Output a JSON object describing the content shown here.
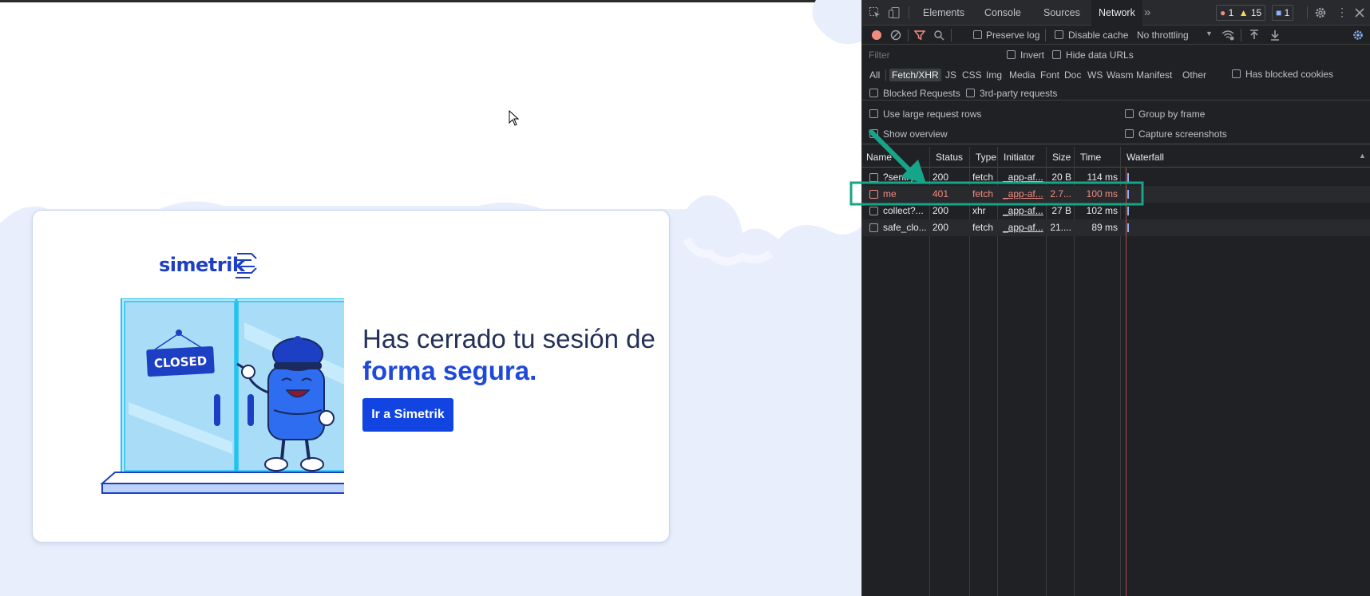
{
  "page": {
    "logo_text": "simetrik",
    "closed_sign": "CLOSED",
    "headline_line1": "Has cerrado tu sesión de",
    "headline_line2": "forma segura.",
    "cta_label": "Ir a Simetrik"
  },
  "devtools": {
    "tabs": [
      "Elements",
      "Console",
      "Sources",
      "Network"
    ],
    "active_tab": "Network",
    "more_tabs": "»",
    "errors_count": "1",
    "warnings_count": "15",
    "messages_count": "1",
    "toolbar": {
      "preserve_log": "Preserve log",
      "disable_cache": "Disable cache",
      "throttling": "No throttling"
    },
    "filter": {
      "placeholder": "Filter",
      "invert": "Invert",
      "hide_data_urls": "Hide data URLs",
      "types": [
        "All",
        "Fetch/XHR",
        "JS",
        "CSS",
        "Img",
        "Media",
        "Font",
        "Doc",
        "WS",
        "Wasm",
        "Manifest",
        "Other"
      ],
      "active_type": "Fetch/XHR",
      "has_blocked_cookies": "Has blocked cookies",
      "blocked_requests": "Blocked Requests",
      "third_party": "3rd-party requests"
    },
    "settings": {
      "large_rows": "Use large request rows",
      "group_by_frame": "Group by frame",
      "show_overview": "Show overview",
      "capture_screenshots": "Capture screenshots"
    },
    "columns": [
      "Name",
      "Status",
      "Type",
      "Initiator",
      "Size",
      "Time",
      "Waterfall"
    ],
    "rows": [
      {
        "name": "?sentry",
        "status": "200",
        "type": "fetch",
        "initiator": "_app-af...",
        "size": "20 B",
        "time": "114 ms",
        "error": false
      },
      {
        "name": "me",
        "status": "401",
        "type": "fetch",
        "initiator": "_app-af...",
        "size": "2.7...",
        "time": "100 ms",
        "error": true
      },
      {
        "name": "collect?...",
        "status": "200",
        "type": "xhr",
        "initiator": "_app-af...",
        "size": "27 B",
        "time": "102 ms",
        "error": false
      },
      {
        "name": "safe_clo...",
        "status": "200",
        "type": "fetch",
        "initiator": "_app-af...",
        "size": "21....",
        "time": "89 ms",
        "error": false
      }
    ]
  },
  "colors": {
    "accent_blue": "#1144e0",
    "headline_blue": "#1f4ad8",
    "annotation_green": "#17a589",
    "error_red": "#f28b82",
    "devtools_bg": "#202124"
  }
}
